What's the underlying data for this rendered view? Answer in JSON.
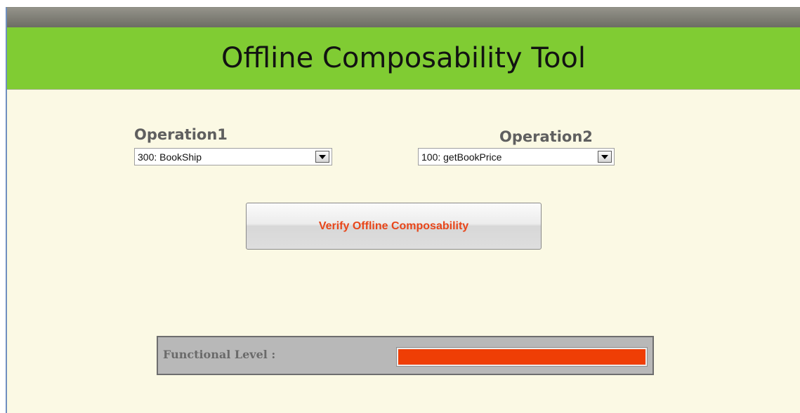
{
  "header": {
    "title": "Offline Composability Tool"
  },
  "operation1": {
    "label": "Operation1",
    "selected": "300: BookShip"
  },
  "operation2": {
    "label": "Operation2",
    "selected": "100: getBookPrice"
  },
  "verify_button": {
    "label": "Verify Offline Composability"
  },
  "functional_level": {
    "label": "Functional Level :",
    "fraction": 1.0,
    "color": "#ef3e05"
  },
  "colors": {
    "header_bg": "#80cc33",
    "page_bg": "#fbf9e4",
    "button_text": "#e8461a"
  }
}
